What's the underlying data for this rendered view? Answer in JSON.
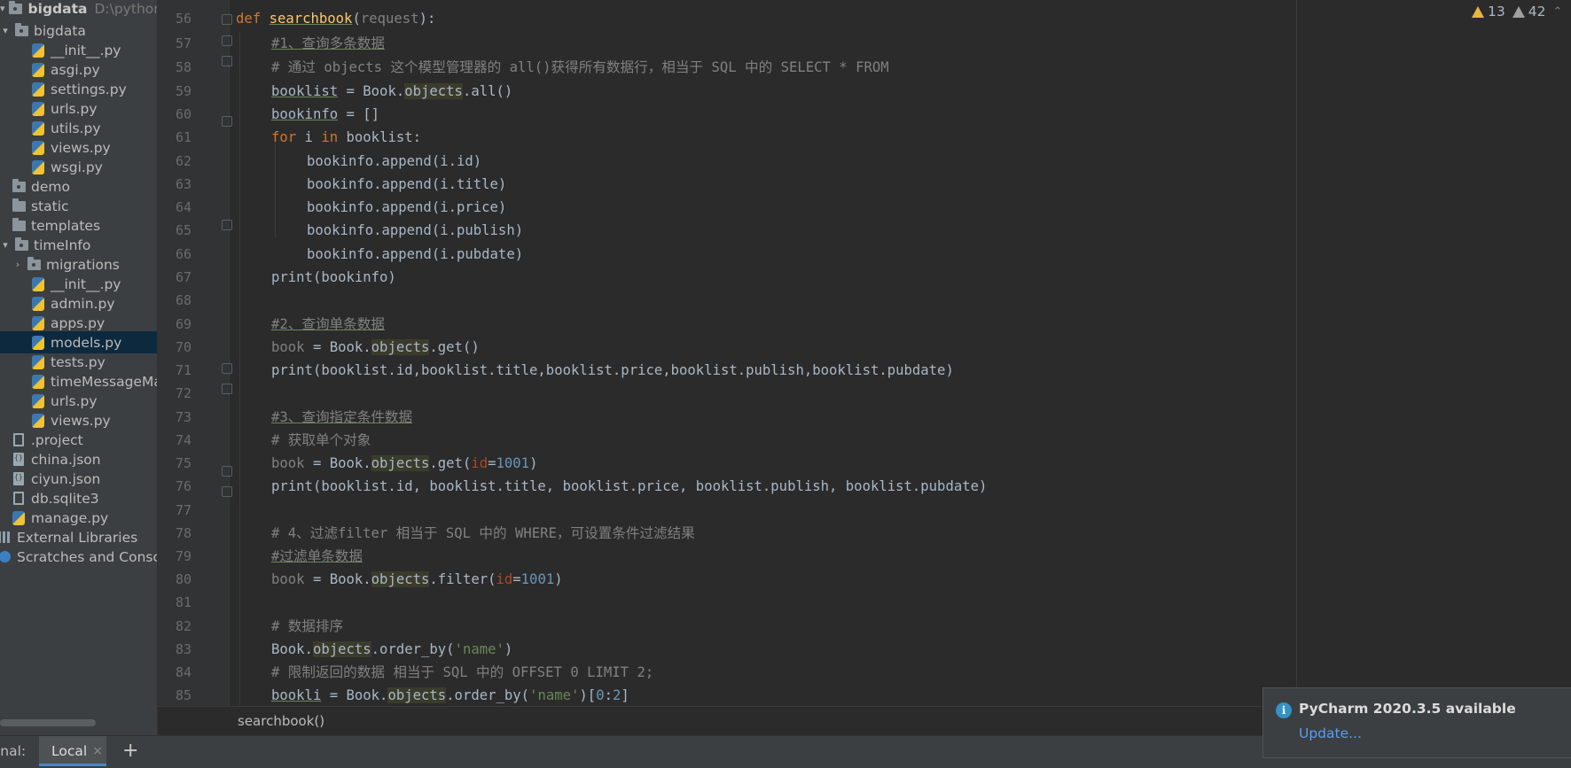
{
  "project": {
    "root_name": "bigdata",
    "root_path": "D:\\pythonPro",
    "items": [
      {
        "label": "bigdata",
        "kind": "folder"
      },
      {
        "label": "__init__.py",
        "kind": "py"
      },
      {
        "label": "asgi.py",
        "kind": "py"
      },
      {
        "label": "settings.py",
        "kind": "py"
      },
      {
        "label": "urls.py",
        "kind": "py"
      },
      {
        "label": "utils.py",
        "kind": "py"
      },
      {
        "label": "views.py",
        "kind": "py"
      },
      {
        "label": "wsgi.py",
        "kind": "py"
      },
      {
        "label": "demo",
        "kind": "folder"
      },
      {
        "label": "static",
        "kind": "folder"
      },
      {
        "label": "templates",
        "kind": "folder"
      },
      {
        "label": "timeInfo",
        "kind": "folder"
      },
      {
        "label": "migrations",
        "kind": "folder"
      },
      {
        "label": "__init__.py",
        "kind": "py"
      },
      {
        "label": "admin.py",
        "kind": "py"
      },
      {
        "label": "apps.py",
        "kind": "py"
      },
      {
        "label": "models.py",
        "kind": "py",
        "selected": true
      },
      {
        "label": "tests.py",
        "kind": "py"
      },
      {
        "label": "timeMessageMa",
        "kind": "py"
      },
      {
        "label": "urls.py",
        "kind": "py"
      },
      {
        "label": "views.py",
        "kind": "py"
      },
      {
        "label": ".project",
        "kind": "text"
      },
      {
        "label": "china.json",
        "kind": "json"
      },
      {
        "label": "ciyun.json",
        "kind": "json"
      },
      {
        "label": "db.sqlite3",
        "kind": "text"
      },
      {
        "label": "manage.py",
        "kind": "py"
      },
      {
        "label": "External Libraries",
        "kind": "libs"
      },
      {
        "label": "Scratches and Consoles",
        "kind": "scratch"
      }
    ]
  },
  "editor": {
    "line_numbers": [
      "56",
      "57",
      "58",
      "59",
      "60",
      "61",
      "62",
      "63",
      "64",
      "65",
      "66",
      "67",
      "68",
      "69",
      "70",
      "71",
      "72",
      "73",
      "74",
      "75",
      "76",
      "77",
      "78",
      "79",
      "80",
      "81",
      "82",
      "83",
      "84",
      "85"
    ],
    "inspections": {
      "warnings": "13",
      "weak_warnings": "42"
    },
    "code": {
      "l56_def": "def",
      "l56_name": "searchbook",
      "l56_param": "request",
      "l57": "#1、查询多条数据",
      "l58": "# 通过 objects 这个模型管理器的 all()获得所有数据行，相当于 SQL 中的 SELECT * FROM",
      "l59_a": "booklist",
      "l59_b": " = Book.",
      "l59_c": "objects",
      "l59_d": ".all()",
      "l60_a": "bookinfo",
      "l60_b": " = []",
      "l61_for": "for",
      "l61_i": " i ",
      "l61_in": "in",
      "l61_rest": " booklist:",
      "l62": "bookinfo.append(i.id)",
      "l63": "bookinfo.append(i.title)",
      "l64": "bookinfo.append(i.price)",
      "l65": "bookinfo.append(i.publish)",
      "l66": "bookinfo.append(i.pubdate)",
      "l67": "print(bookinfo)",
      "l69": "#2、查询单条数据",
      "l70_a": "book",
      "l70_b": " = Book.",
      "l70_c": "objects",
      "l70_d": ".get()",
      "l71": "print(booklist.id,booklist.title,booklist.price,booklist.publish,booklist.pubdate)",
      "l73": "#3、查询指定条件数据",
      "l74": "# 获取单个对象",
      "l75_a": "book",
      "l75_b": " = Book.",
      "l75_c": "objects",
      "l75_d": ".get(",
      "l75_e": "id",
      "l75_f": "=",
      "l75_g": "1001",
      "l75_h": ")",
      "l76": "print(booklist.id, booklist.title, booklist.price, booklist.publish, booklist.pubdate)",
      "l78": "# 4、过滤filter 相当于 SQL 中的 WHERE，可设置条件过滤结果",
      "l79": "#过滤单条数据",
      "l80_a": "book",
      "l80_b": " = Book.",
      "l80_c": "objects",
      "l80_d": ".filter(",
      "l80_e": "id",
      "l80_f": "=",
      "l80_g": "1001",
      "l80_h": ")",
      "l82": "# 数据排序",
      "l83_a": "Book.",
      "l83_b": "objects",
      "l83_c": ".order_by(",
      "l83_d": "'name'",
      "l83_e": ")",
      "l84": "# 限制返回的数据 相当于 SQL 中的 OFFSET 0 LIMIT 2;",
      "l85_a": "bookli",
      "l85_b": " = Book.",
      "l85_c": "objects",
      "l85_d": ".order_by(",
      "l85_e": "'name'",
      "l85_f": ")[",
      "l85_g": "0",
      "l85_h": ":",
      "l85_i": "2",
      "l85_j": "]"
    }
  },
  "breadcrumb": "searchbook()",
  "terminal": {
    "title": "inal:",
    "tab_label": "Local",
    "close": "×",
    "add": "+"
  },
  "notification": {
    "title": "PyCharm 2020.3.5 available",
    "link": "Update..."
  },
  "colors": {
    "background": "#2b2b2b",
    "keyword": "#cc7832",
    "function": "#ffc66d",
    "comment": "#808080",
    "number": "#6897bb",
    "string": "#6a8759",
    "selection": "#0d293e"
  }
}
